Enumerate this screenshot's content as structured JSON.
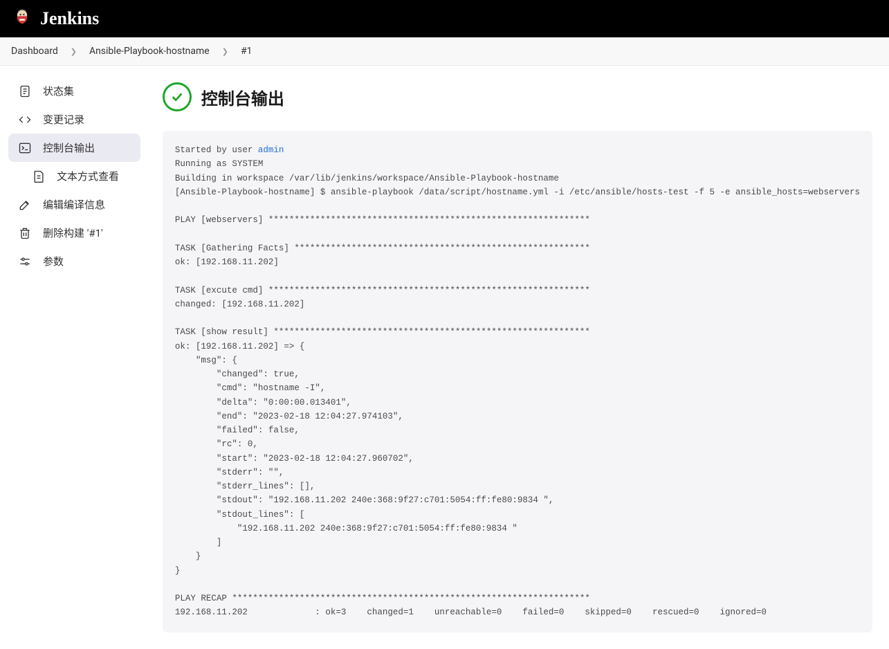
{
  "header": {
    "title": "Jenkins"
  },
  "breadcrumb": [
    "Dashboard",
    "Ansible-Playbook-hostname",
    "#1"
  ],
  "sidebar": {
    "status": "状态集",
    "changes": "变更记录",
    "console": "控制台输出",
    "textview": "文本方式查看",
    "editbuild": "编辑编译信息",
    "deletebuild": "删除构建 '#1'",
    "params": "参数"
  },
  "page": {
    "title": "控制台输出"
  },
  "console": {
    "started_prefix": "Started by user ",
    "started_user": "admin",
    "body": "Running as SYSTEM\nBuilding in workspace /var/lib/jenkins/workspace/Ansible-Playbook-hostname\n[Ansible-Playbook-hostname] $ ansible-playbook /data/script/hostname.yml -i /etc/ansible/hosts-test -f 5 -e ansible_hosts=webservers\n\nPLAY [webservers] **************************************************************\n\nTASK [Gathering Facts] *********************************************************\nok: [192.168.11.202]\n\nTASK [excute cmd] **************************************************************\nchanged: [192.168.11.202]\n\nTASK [show result] *************************************************************\nok: [192.168.11.202] => {\n    \"msg\": {\n        \"changed\": true,\n        \"cmd\": \"hostname -I\",\n        \"delta\": \"0:00:00.013401\",\n        \"end\": \"2023-02-18 12:04:27.974103\",\n        \"failed\": false,\n        \"rc\": 0,\n        \"start\": \"2023-02-18 12:04:27.960702\",\n        \"stderr\": \"\",\n        \"stderr_lines\": [],\n        \"stdout\": \"192.168.11.202 240e:368:9f27:c701:5054:ff:fe80:9834 \",\n        \"stdout_lines\": [\n            \"192.168.11.202 240e:368:9f27:c701:5054:ff:fe80:9834 \"\n        ]\n    }\n}\n\nPLAY RECAP *********************************************************************\n192.168.11.202             : ok=3    changed=1    unreachable=0    failed=0    skipped=0    rescued=0    ignored=0"
  }
}
